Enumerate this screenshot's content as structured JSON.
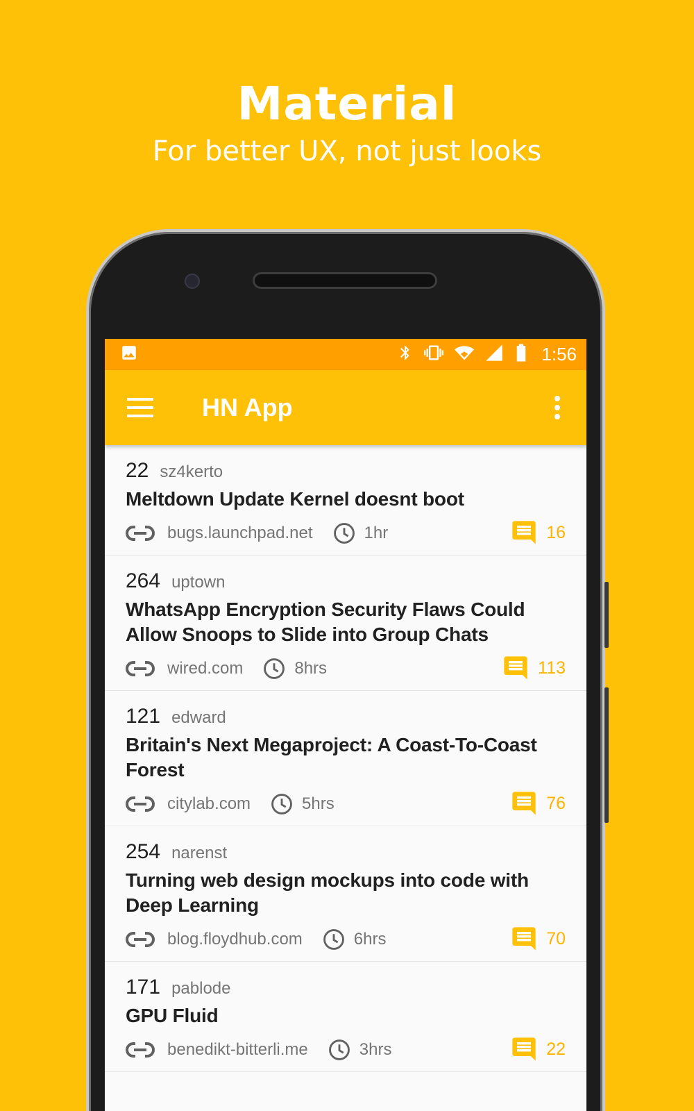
{
  "promo": {
    "title": "Material",
    "subtitle": "For better UX, not just looks"
  },
  "status_bar": {
    "time": "1:56",
    "icons": [
      "image-icon",
      "bluetooth-icon",
      "vibrate-icon",
      "wifi-icon",
      "signal-icon",
      "battery-icon"
    ]
  },
  "app_bar": {
    "title": "HN App",
    "menu_icon": "hamburger-menu-icon",
    "overflow_icon": "more-vert-icon"
  },
  "colors": {
    "background": "#FFC107",
    "status_bar": "#FFA000",
    "accent": "#FFB300",
    "text_primary": "#212121",
    "text_secondary": "#757575"
  },
  "stories": [
    {
      "points": "22",
      "author": "sz4kerto",
      "title": "Meltdown Update Kernel doesnt boot",
      "domain": "bugs.launchpad.net",
      "time": "1hr",
      "comments": "16"
    },
    {
      "points": "264",
      "author": "uptown",
      "title": "WhatsApp Encryption Security Flaws Could Allow Snoops to Slide into Group Chats",
      "domain": "wired.com",
      "time": "8hrs",
      "comments": "113"
    },
    {
      "points": "121",
      "author": "edward",
      "title": "Britain's Next Megaproject: A Coast-To-Coast Forest",
      "domain": "citylab.com",
      "time": "5hrs",
      "comments": "76"
    },
    {
      "points": "254",
      "author": "narenst",
      "title": "Turning web design mockups into code with Deep Learning",
      "domain": "blog.floydhub.com",
      "time": "6hrs",
      "comments": "70"
    },
    {
      "points": "171",
      "author": "pablode",
      "title": "GPU Fluid",
      "domain": "benedikt-bitterli.me",
      "time": "3hrs",
      "comments": "22"
    }
  ]
}
